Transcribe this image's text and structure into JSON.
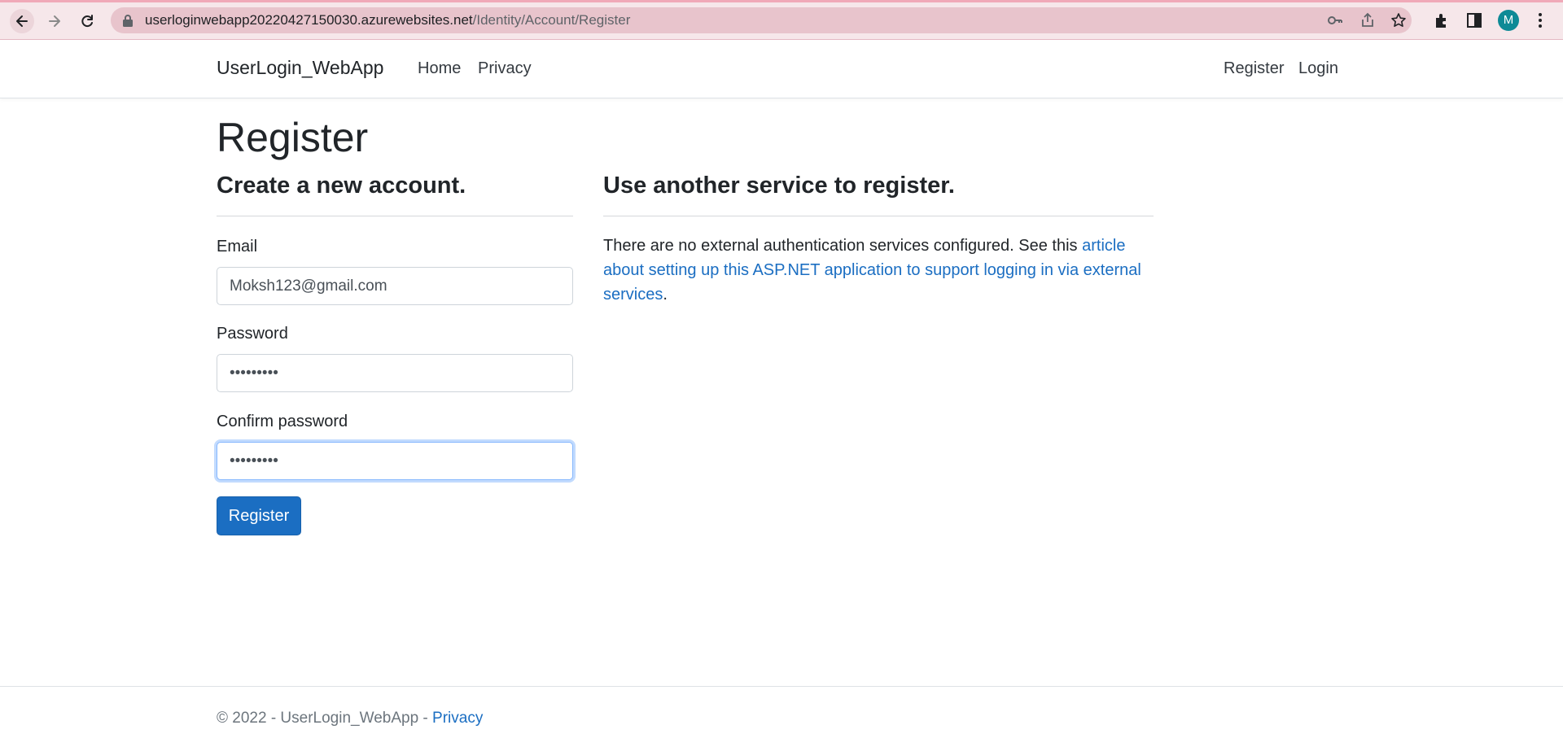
{
  "browser": {
    "url_host": "userloginwebapp20220427150030.azurewebsites.net",
    "url_path": "/Identity/Account/Register",
    "profile_initial": "M"
  },
  "navbar": {
    "brand": "UserLogin_WebApp",
    "links": [
      "Home",
      "Privacy"
    ],
    "right_links": [
      "Register",
      "Login"
    ]
  },
  "page": {
    "title": "Register",
    "form_heading": "Create a new account.",
    "external_heading": "Use another service to register.",
    "email_label": "Email",
    "email_value": "Moksh123@gmail.com",
    "password_label": "Password",
    "password_value": "•••••••••",
    "confirm_label": "Confirm password",
    "confirm_value": "•••••••••",
    "submit_label": "Register",
    "external_text": "There are no external authentication services configured. See this ",
    "external_link": "article about setting up this ASP.NET application to support logging in via external services",
    "external_end": "."
  },
  "footer": {
    "copyright": "© 2022 - UserLogin_WebApp - ",
    "privacy_link": "Privacy"
  },
  "colors": {
    "primary": "#1b6ec2",
    "chrome_bg": "#f6e7ea",
    "avatar": "#0e8a96"
  }
}
